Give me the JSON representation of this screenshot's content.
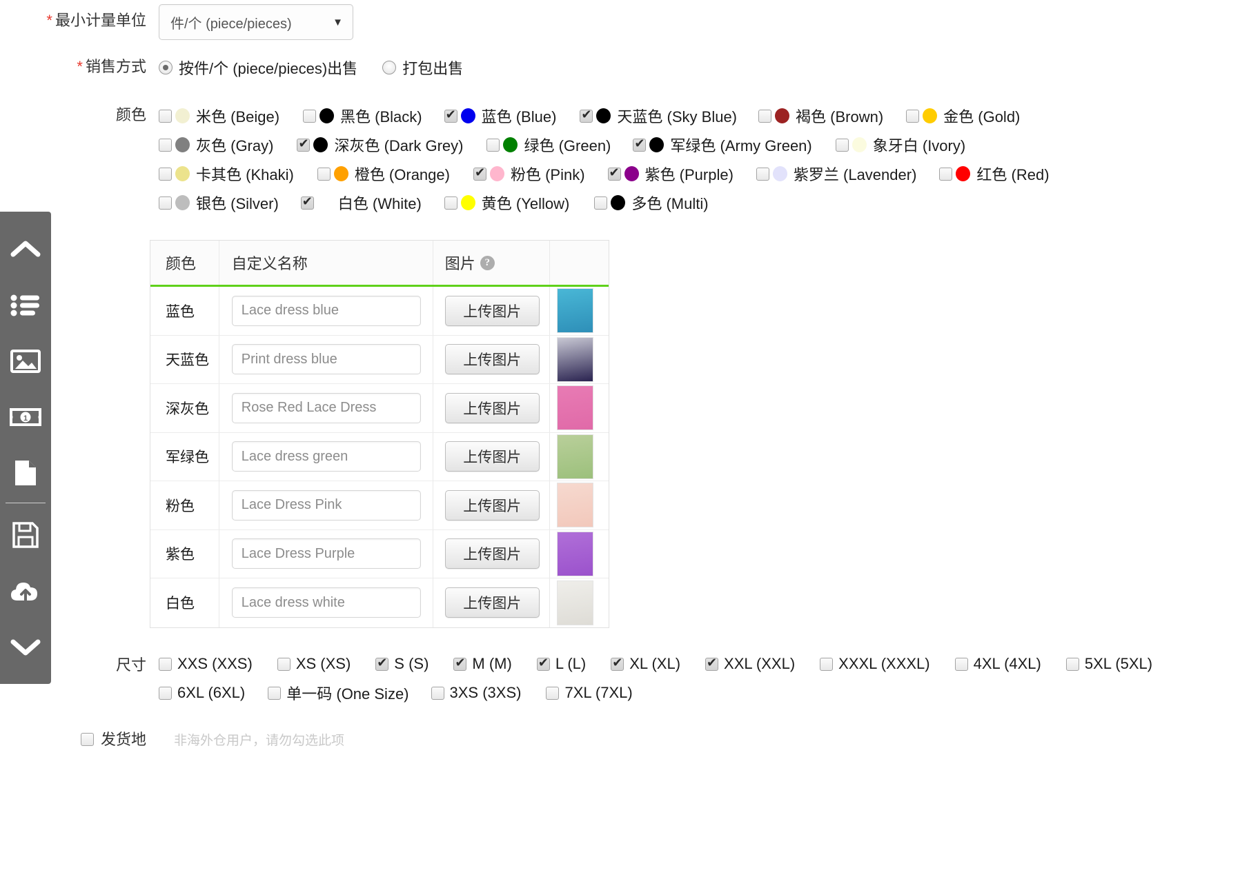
{
  "form": {
    "unit": {
      "label": "最小计量单位",
      "required": true,
      "selected": "件/个 (piece/pieces)",
      "caret": "▼"
    },
    "sale_method": {
      "label": "销售方式",
      "required": true,
      "options": [
        {
          "label": "按件/个 (piece/pieces)出售",
          "checked": true
        },
        {
          "label": "打包出售",
          "checked": false
        }
      ]
    },
    "color": {
      "label": "颜色",
      "rows": [
        [
          {
            "label": "米色 (Beige)",
            "swatch": "#f2f0d2",
            "checked": false
          },
          {
            "label": "黑色 (Black)",
            "swatch": "#000000",
            "checked": false
          },
          {
            "label": "蓝色 (Blue)",
            "swatch": "#0000ee",
            "checked": true
          },
          {
            "label": "天蓝色 (Sky Blue)",
            "swatch": "#000000",
            "checked": true
          },
          {
            "label": "褐色 (Brown)",
            "swatch": "#9c2222",
            "checked": false
          },
          {
            "label": "金色 (Gold)",
            "swatch": "#ffcc00",
            "checked": false
          }
        ],
        [
          {
            "label": "灰色 (Gray)",
            "swatch": "#808080",
            "checked": false
          },
          {
            "label": "深灰色 (Dark Grey)",
            "swatch": "#000000",
            "checked": true
          },
          {
            "label": "绿色 (Green)",
            "swatch": "#008000",
            "checked": false
          },
          {
            "label": "军绿色 (Army Green)",
            "swatch": "#000000",
            "checked": true
          },
          {
            "label": "象牙白 (Ivory)",
            "swatch": "#fbfbdf",
            "checked": false
          }
        ],
        [
          {
            "label": "卡其色 (Khaki)",
            "swatch": "#ece38c",
            "checked": false
          },
          {
            "label": "橙色 (Orange)",
            "swatch": "#ffa000",
            "checked": false
          },
          {
            "label": "粉色 (Pink)",
            "swatch": "#ffb6cd",
            "checked": true
          },
          {
            "label": "紫色 (Purple)",
            "swatch": "#8b008b",
            "checked": true
          },
          {
            "label": "紫罗兰 (Lavender)",
            "swatch": "#e2e2fb",
            "checked": false
          },
          {
            "label": "红色 (Red)",
            "swatch": "#ff0000",
            "checked": false
          }
        ],
        [
          {
            "label": "银色 (Silver)",
            "swatch": "#bdbdbd",
            "checked": false
          },
          {
            "label": "白色 (White)",
            "swatch": "#ffffff",
            "checked": true
          },
          {
            "label": "黄色 (Yellow)",
            "swatch": "#ffff00",
            "checked": false
          },
          {
            "label": "多色 (Multi)",
            "swatch": "#000000",
            "checked": false
          }
        ]
      ]
    },
    "color_table": {
      "headers": {
        "color": "颜色",
        "custom_name": "自定义名称",
        "image": "图片",
        "help_glyph": "?"
      },
      "upload_label": "上传图片",
      "rows": [
        {
          "color": "蓝色",
          "name_placeholder": "Lace dress blue",
          "thumb_top": "#49b7d6",
          "thumb_bottom": "#2e8fb8"
        },
        {
          "color": "天蓝色",
          "name_placeholder": "Print dress blue",
          "thumb_top": "#c8c8d4",
          "thumb_bottom": "#2a2350"
        },
        {
          "color": "深灰色",
          "name_placeholder": "Rose Red Lace Dress",
          "thumb_top": "#e87bb4",
          "thumb_bottom": "#e06aa8"
        },
        {
          "color": "军绿色",
          "name_placeholder": "Lace dress green",
          "thumb_top": "#b9cf9a",
          "thumb_bottom": "#9cc07c"
        },
        {
          "color": "粉色",
          "name_placeholder": "Lace Dress Pink",
          "thumb_top": "#f6d9cf",
          "thumb_bottom": "#f2c8bb"
        },
        {
          "color": "紫色",
          "name_placeholder": "Lace Dress Purple",
          "thumb_top": "#b06fd8",
          "thumb_bottom": "#9b52cc"
        },
        {
          "color": "白色",
          "name_placeholder": "Lace dress white",
          "thumb_top": "#efeeea",
          "thumb_bottom": "#dedcd6"
        }
      ]
    },
    "size": {
      "label": "尺寸",
      "rows": [
        [
          {
            "label": "XXS (XXS)",
            "checked": false
          },
          {
            "label": "XS (XS)",
            "checked": false
          },
          {
            "label": "S (S)",
            "checked": true
          },
          {
            "label": "M (M)",
            "checked": true
          },
          {
            "label": "L (L)",
            "checked": true
          },
          {
            "label": "XL (XL)",
            "checked": true
          },
          {
            "label": "XXL (XXL)",
            "checked": true
          },
          {
            "label": "XXXL (XXXL)",
            "checked": false
          },
          {
            "label": "4XL (4XL)",
            "checked": false
          },
          {
            "label": "5XL (5XL)",
            "checked": false
          }
        ],
        [
          {
            "label": "6XL (6XL)",
            "checked": false
          },
          {
            "label": "单一码 (One Size)",
            "checked": false
          },
          {
            "label": "3XS (3XS)",
            "checked": false
          },
          {
            "label": "7XL (7XL)",
            "checked": false
          }
        ]
      ]
    },
    "shipping": {
      "label": "发货地",
      "checked": false,
      "note": "非海外仓用户，请勿勾选此项"
    }
  },
  "sidebar": {
    "items": [
      {
        "icon": "chevron-up-icon"
      },
      {
        "icon": "list-icon"
      },
      {
        "icon": "image-icon"
      },
      {
        "icon": "money-icon"
      },
      {
        "icon": "document-icon"
      },
      {
        "icon": "separator"
      },
      {
        "icon": "save-icon"
      },
      {
        "icon": "cloud-upload-icon"
      },
      {
        "icon": "chevron-down-icon"
      }
    ]
  },
  "colors": {
    "accent_green": "#5fd11a",
    "required_red": "#e8392e",
    "sidebar_bg": "#686868"
  }
}
